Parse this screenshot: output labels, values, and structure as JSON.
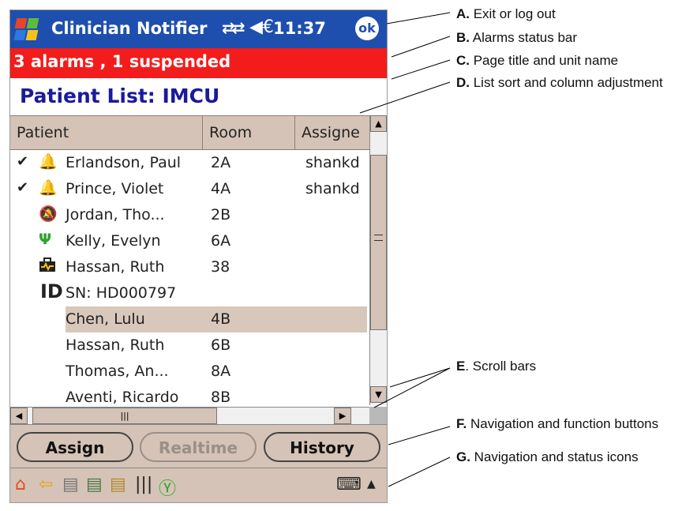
{
  "status_bar": {
    "app_title": "Clinician Notifier",
    "time": "11:37",
    "ok_label": "ok",
    "icons": [
      "windows-start-icon",
      "sync-arrows-icon",
      "volume-icon"
    ]
  },
  "alarm_bar": {
    "text": "3 alarms , 1 suspended",
    "color": "#f31c1c"
  },
  "page": {
    "title": "Patient List: IMCU",
    "title_color": "#1a1a9c"
  },
  "table": {
    "columns": [
      "Patient",
      "Room",
      "Assigne"
    ],
    "rows": [
      {
        "check": "✔",
        "icon": "red-alarm-bell-icon",
        "patient": "Erlandson, Paul",
        "room": "2A",
        "assigned": "shankd"
      },
      {
        "check": "✔",
        "icon": "yellow-alarm-bell-icon",
        "patient": "Prince, Violet",
        "room": "4A",
        "assigned": "shankd"
      },
      {
        "check": "",
        "icon": "silenced-bell-icon",
        "patient": "Jordan, Tho...",
        "room": "2B",
        "assigned": ""
      },
      {
        "check": "",
        "icon": "green-lead-icon",
        "patient": "Kelly, Evelyn",
        "room": "6A",
        "assigned": ""
      },
      {
        "check": "",
        "icon": "telemetry-device-icon",
        "patient": "Hassan, Ruth",
        "room": "38",
        "assigned": ""
      },
      {
        "check": "",
        "icon": "id-icon",
        "patient": "SN: HD000797",
        "room": "",
        "assigned": ""
      },
      {
        "check": "",
        "icon": "",
        "patient": "Chen, Lulu",
        "room": "4B",
        "assigned": "",
        "selected": true
      },
      {
        "check": "",
        "icon": "",
        "patient": "Hassan, Ruth",
        "room": "6B",
        "assigned": ""
      },
      {
        "check": "",
        "icon": "",
        "patient": "Thomas, An...",
        "room": "8A",
        "assigned": ""
      },
      {
        "check": "",
        "icon": "",
        "patient": "Aventi, Ricardo",
        "room": "8B",
        "assigned": ""
      }
    ],
    "id_glyph": "ID"
  },
  "buttons": {
    "assign": "Assign",
    "realtime": "Realtime",
    "history": "History"
  },
  "callouts": {
    "a_key": "A.",
    "a_text": " Exit or log out",
    "b_key": "B.",
    "b_text": " Alarms status bar",
    "c_key": "C.",
    "c_text": " Page title and unit name",
    "d_key": "D.",
    "d_text": " List sort and column adjustment",
    "e_key": "E",
    "e_text": ". Scroll bars",
    "f_key": "F.",
    "f_text": " Navigation and function buttons",
    "g_key": "G.",
    "g_text": " Navigation and status icons"
  },
  "colors": {
    "title_bar": "#1f4fae",
    "chrome": "#d4c3b6",
    "selected_row": "#d8c8bb"
  }
}
